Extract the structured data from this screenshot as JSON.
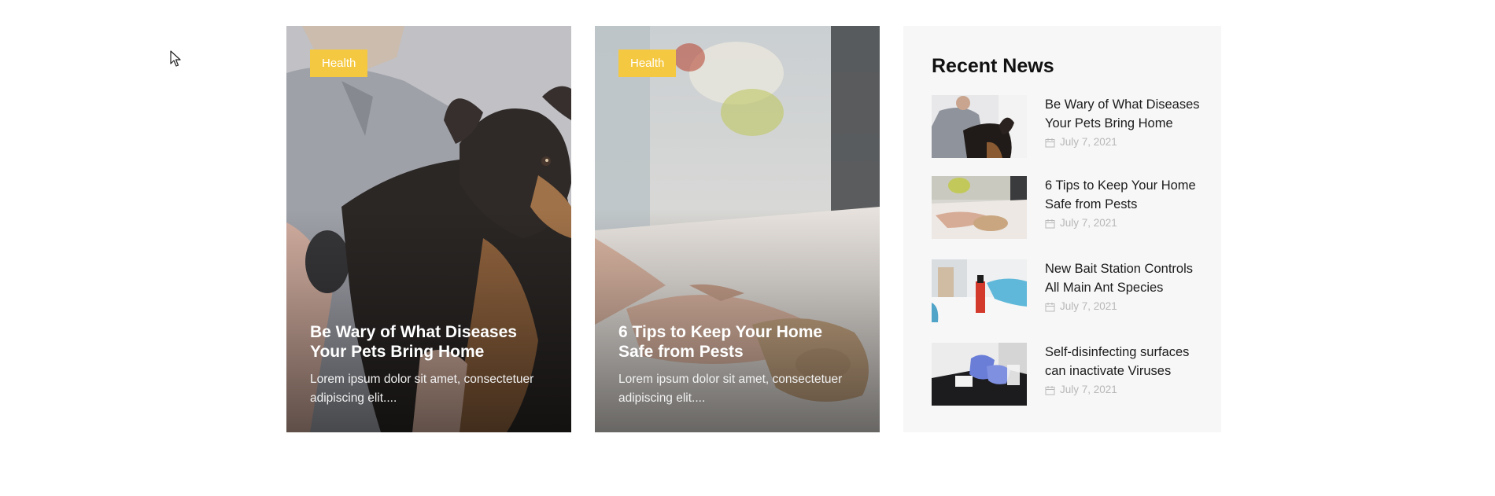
{
  "cards": [
    {
      "category": "Health",
      "title": "Be Wary of What Diseases Your Pets Bring Home",
      "excerpt": "Lorem ipsum dolor sit amet, consectetuer adipiscing elit...."
    },
    {
      "category": "Health",
      "title": "6 Tips to Keep Your Home Safe from Pests",
      "excerpt": "Lorem ipsum dolor sit amet, consectetuer adipiscing elit...."
    }
  ],
  "sidebar": {
    "title": "Recent News",
    "items": [
      {
        "title": "Be Wary of What Diseases Your Pets Bring Home",
        "date": "July 7, 2021"
      },
      {
        "title": "6 Tips to Keep Your Home Safe from Pests",
        "date": "July 7, 2021"
      },
      {
        "title": "New Bait Station Controls All Main Ant Species",
        "date": "July 7, 2021"
      },
      {
        "title": "Self-disinfecting surfaces can inactivate Viruses",
        "date": "July 7, 2021"
      }
    ]
  },
  "colors": {
    "badge": "#f5c842",
    "sidebar_bg": "#f7f7f7",
    "date_text": "#b8b8b8"
  }
}
